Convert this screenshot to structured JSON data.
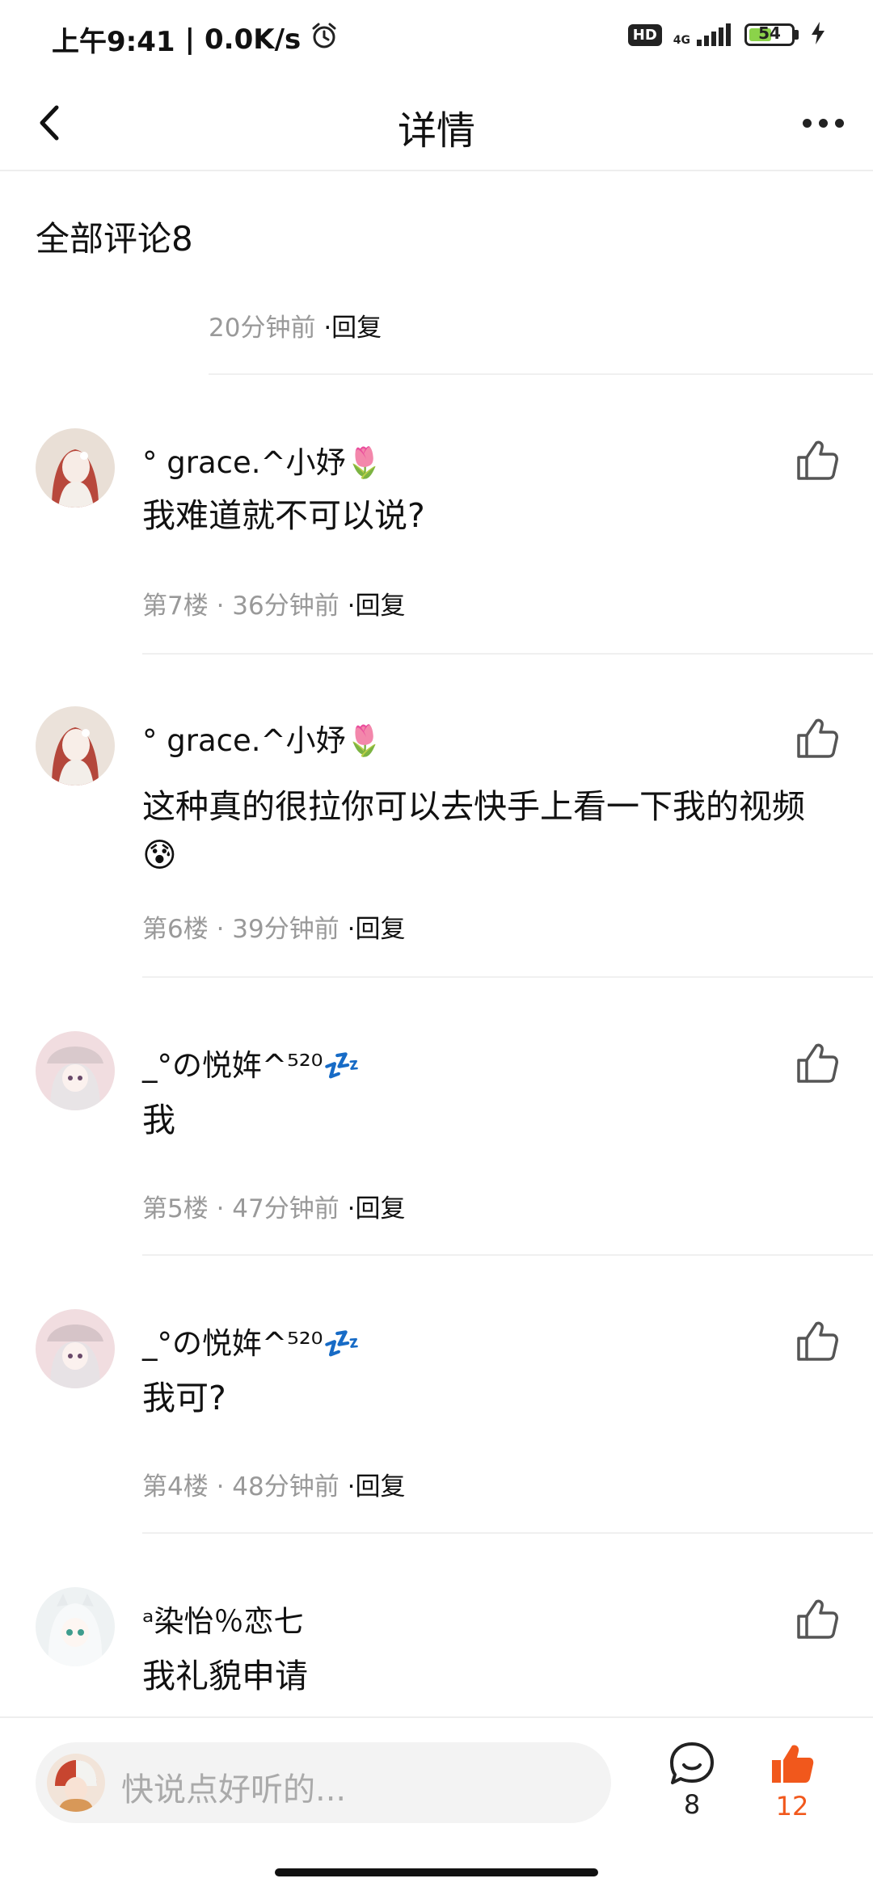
{
  "status_bar": {
    "time": "上午9:41",
    "speed": "0.0K/s",
    "hd": "HD",
    "network": "4G",
    "battery": "54",
    "battery_level": 0.54
  },
  "nav": {
    "title": "详情"
  },
  "section": {
    "title": "全部评论8"
  },
  "prev_item": {
    "time": "20分钟前",
    "reply": "·回复"
  },
  "comments": [
    {
      "username": "° grace.^小妤🌷",
      "content": "我难道就不可以说?",
      "floor": "第7楼",
      "time": "36分钟前",
      "reply": "·回复"
    },
    {
      "username": "° grace.^小妤🌷",
      "content": "这种真的很拉你可以去快手上看一下我的视频 😰",
      "floor": "第6楼",
      "time": "39分钟前",
      "reply": "·回复"
    },
    {
      "username": "_°の悦姩^⁵²⁰💤",
      "content": "我",
      "floor": "第5楼",
      "time": "47分钟前",
      "reply": "·回复"
    },
    {
      "username": "_°の悦姩^⁵²⁰💤",
      "content": "我可?",
      "floor": "第4楼",
      "time": "48分钟前",
      "reply": "·回复"
    },
    {
      "username": "ᵃ染怡％恋七",
      "content": "我礼貌申请",
      "floor": "",
      "time": "",
      "reply": ""
    }
  ],
  "bottom_bar": {
    "placeholder": "快说点好听的...",
    "comment_count": "8",
    "like_count": "12"
  },
  "colors": {
    "accent": "#f1581c",
    "meta": "#999999",
    "battery_fill": "#8bd34a"
  }
}
